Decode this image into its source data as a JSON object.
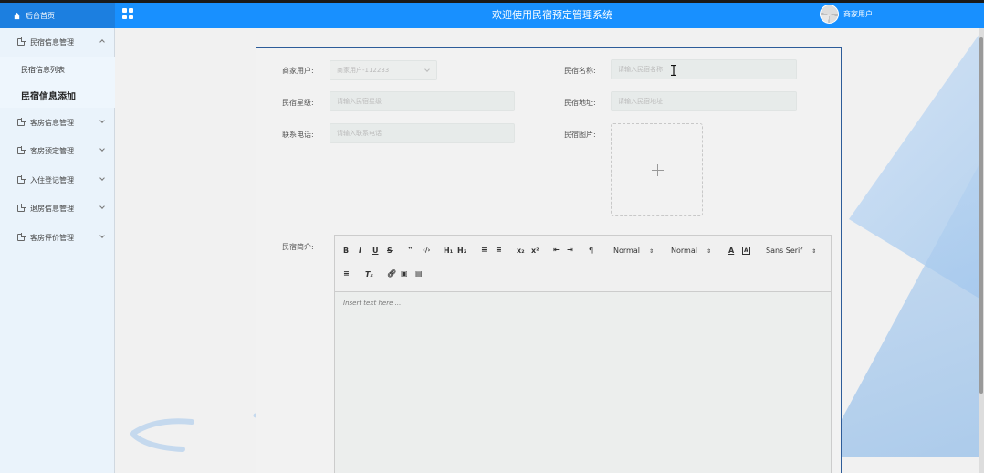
{
  "header": {
    "home_label": "后台首页",
    "title": "欢迎使用民宿预定管理系统",
    "user_label": "商家用户"
  },
  "sidebar": {
    "items": [
      {
        "label": "民宿信息管理",
        "expanded": true
      },
      {
        "label": "客房信息管理",
        "expanded": false
      },
      {
        "label": "客房预定管理",
        "expanded": false
      },
      {
        "label": "入住登记管理",
        "expanded": false
      },
      {
        "label": "退房信息管理",
        "expanded": false
      },
      {
        "label": "客房评价管理",
        "expanded": false
      }
    ],
    "subitems": [
      {
        "label": "民宿信息列表",
        "active": false
      },
      {
        "label": "民宿信息添加",
        "active": true
      }
    ]
  },
  "form": {
    "merchant_user": {
      "label": "商家用户:",
      "value": "商家用户-112233"
    },
    "homestay_name": {
      "label": "民宿名称:",
      "placeholder": "请输入民宿名称"
    },
    "homestay_grade": {
      "label": "民宿星级:",
      "placeholder": "请输入民宿星级"
    },
    "homestay_address": {
      "label": "民宿地址:",
      "placeholder": "请输入民宿地址"
    },
    "phone": {
      "label": "联系电话:",
      "placeholder": "请输入联系电话"
    },
    "image": {
      "label": "民宿图片:"
    },
    "intro": {
      "label": "民宿简介:",
      "placeholder": "Insert text here ..."
    }
  },
  "editor_toolbar": {
    "header_select": "Normal",
    "size_select": "Normal",
    "font_select": "Sans Serif"
  },
  "colors": {
    "header_blue": "#1890ff",
    "card_border": "#2d5c99"
  }
}
